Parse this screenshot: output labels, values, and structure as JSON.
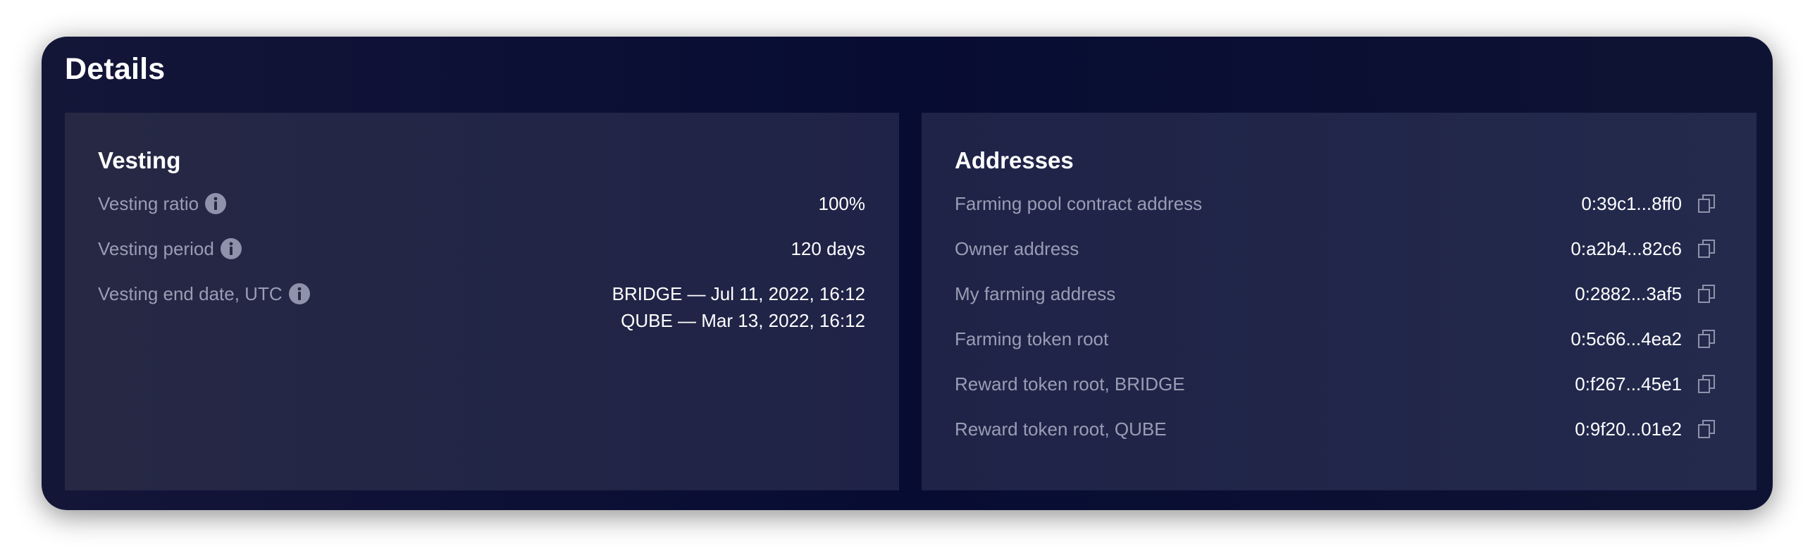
{
  "details": {
    "title": "Details"
  },
  "vesting": {
    "title": "Vesting",
    "rows": [
      {
        "label": "Vesting ratio",
        "value": "100%"
      },
      {
        "label": "Vesting period",
        "value": "120 days"
      },
      {
        "label": "Vesting end date, UTC",
        "values": [
          "BRIDGE — Jul 11, 2022, 16:12",
          "QUBE — Mar 13, 2022, 16:12"
        ]
      }
    ]
  },
  "addresses": {
    "title": "Addresses",
    "rows": [
      {
        "label": "Farming pool contract address",
        "value": "0:39c1...8ff0"
      },
      {
        "label": "Owner address",
        "value": "0:a2b4...82c6"
      },
      {
        "label": "My farming address",
        "value": "0:2882...3af5"
      },
      {
        "label": "Farming token root",
        "value": "0:5c66...4ea2"
      },
      {
        "label": "Reward token root, BRIDGE",
        "value": "0:f267...45e1"
      },
      {
        "label": "Reward token root, QUBE",
        "value": "0:9f20...01e2"
      }
    ]
  },
  "colors": {
    "card_background": "#070c33",
    "panel_background": "#222546",
    "label_text": "#9a9db4",
    "value_text": "#ffffff",
    "icon": "#8f92ab"
  },
  "icons": {
    "info": "info-icon",
    "copy": "copy-icon"
  }
}
